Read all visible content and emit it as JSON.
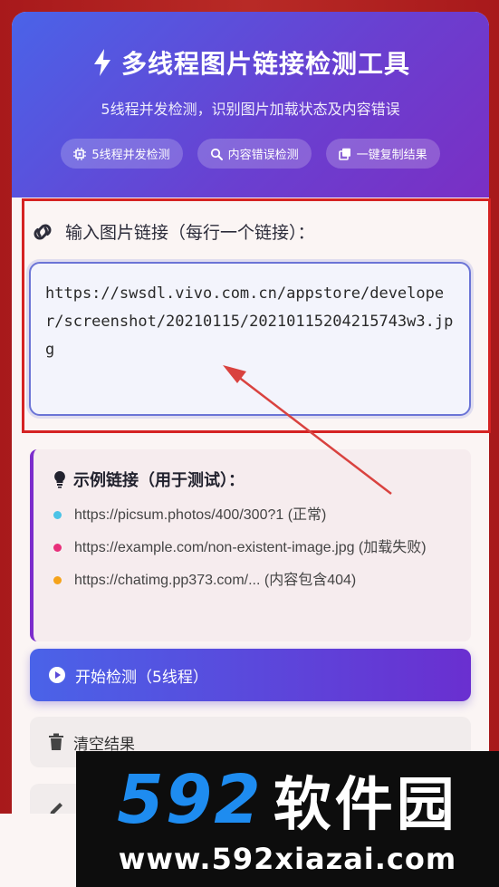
{
  "header": {
    "title": "多线程图片链接检测工具",
    "subtitle": "5线程并发检测，识别图片加载状态及内容错误",
    "badges": [
      {
        "label": "5线程并发检测",
        "icon": "cpu-icon"
      },
      {
        "label": "内容错误检测",
        "icon": "search-icon"
      },
      {
        "label": "一键复制结果",
        "icon": "copy-icon"
      }
    ]
  },
  "input": {
    "label": "输入图片链接（每行一个链接）：",
    "value": "https://swsdl.vivo.com.cn/appstore/developer/screenshot/20210115/20210115204215743w3.jpg"
  },
  "examples": {
    "title": "示例链接（用于测试）：",
    "items": [
      {
        "text": "https://picsum.photos/400/300?1 (正常)",
        "color": "#4cc3e6"
      },
      {
        "text": "https://example.com/non-existent-image.jpg (加载失败)",
        "color": "#e82f7a"
      },
      {
        "text": "https://chatimg.pp373.com/... (内容包含404)",
        "color": "#f5a31a"
      }
    ]
  },
  "buttons": {
    "start": "开始检测（5线程）",
    "clear": "清空结果"
  },
  "watermark": {
    "number": "592",
    "name": "软件园",
    "url": "www.592xiazai.com"
  },
  "colors": {
    "accent_start": "#4a63e8",
    "accent_end": "#7a2fc4",
    "annotation_red": "#d52323"
  }
}
